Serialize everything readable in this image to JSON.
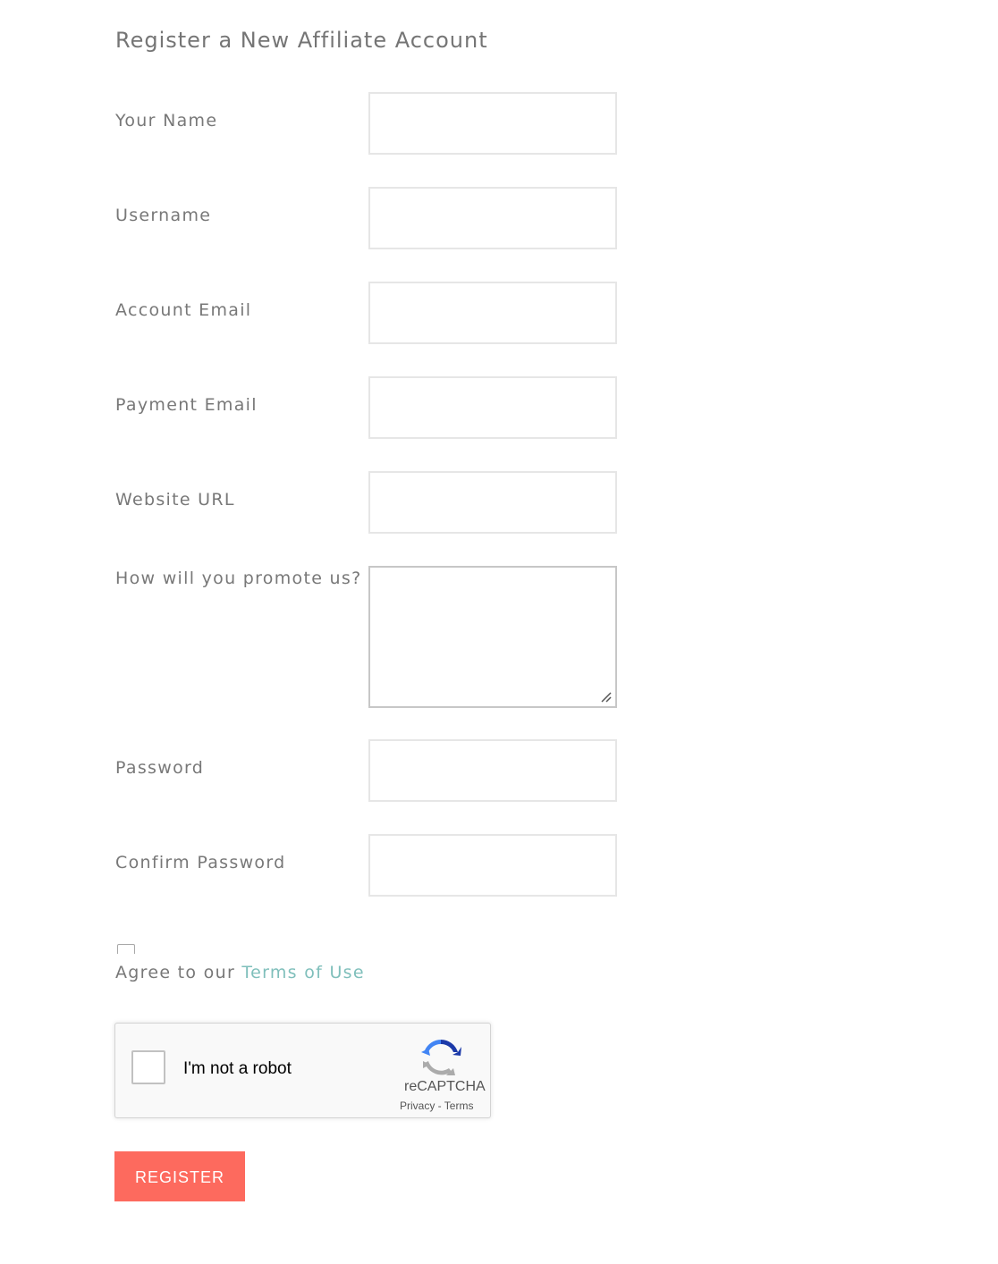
{
  "form": {
    "title": "Register a New Affiliate Account",
    "fields": {
      "your_name": {
        "label": "Your Name",
        "value": ""
      },
      "username": {
        "label": "Username",
        "value": ""
      },
      "account_email": {
        "label": "Account Email",
        "value": ""
      },
      "payment_email": {
        "label": "Payment Email",
        "value": ""
      },
      "website_url": {
        "label": "Website URL",
        "value": ""
      },
      "promotion": {
        "label": "How will you promote us?",
        "value": ""
      },
      "password": {
        "label": "Password",
        "value": ""
      },
      "confirm_password": {
        "label": "Confirm Password",
        "value": ""
      }
    },
    "agree": {
      "checked": false,
      "prefix": "Agree to our ",
      "link_text": "Terms of Use"
    },
    "recaptcha": {
      "checked": false,
      "label": "I'm not a robot",
      "brand": "reCAPTCHA",
      "links": "Privacy - Terms",
      "icon": "recaptcha-logo"
    },
    "submit_label": "REGISTER"
  },
  "colors": {
    "accent_button": "#fd6a5e",
    "link": "#7fbfbb",
    "label_text": "#787878",
    "field_border": "#e6e6e6"
  }
}
